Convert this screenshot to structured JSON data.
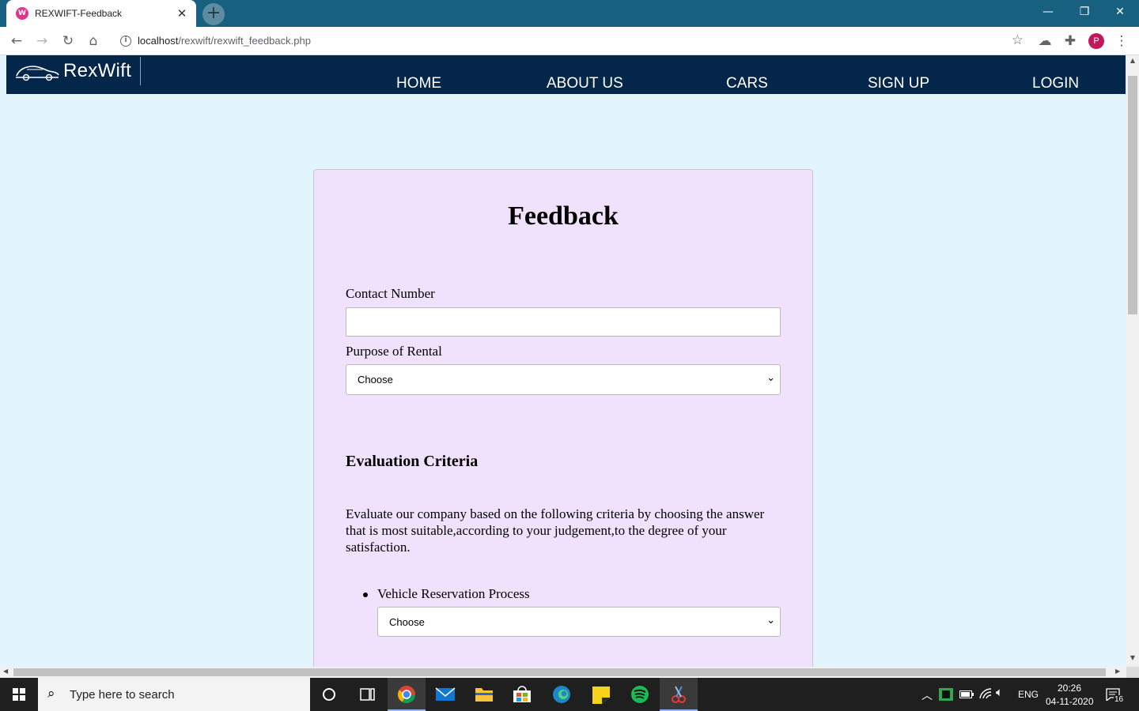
{
  "browser": {
    "tab_title": "REXWIFT-Feedback",
    "tab_favicon_letter": "W",
    "close_tab_glyph": "✕",
    "new_tab_glyph": "+",
    "url_host": "localhost",
    "url_path": "/rexwift/rexwift_feedback.php",
    "profile_initial": "P",
    "window_controls": {
      "minimize": "—",
      "restore": "❐",
      "close": "✕"
    },
    "icons": [
      "back-arrow-icon",
      "forward-arrow-icon",
      "reload-icon",
      "home-icon",
      "site-info-icon",
      "bookmark-star-icon",
      "cloud-extension-icon",
      "puzzle-extensions-icon",
      "kebab-menu-icon"
    ]
  },
  "site": {
    "logo_text": "RexWift",
    "nav": [
      {
        "label": "HOME"
      },
      {
        "label": "ABOUT US"
      },
      {
        "label": "CARS"
      },
      {
        "label": "SIGN UP"
      },
      {
        "label": "LOGIN"
      }
    ]
  },
  "form": {
    "title": "Feedback",
    "contact_label": "Contact Number",
    "contact_value": "",
    "purpose_label": "Purpose of Rental",
    "purpose_selected": "Choose",
    "section_heading": "Evaluation Criteria",
    "instructions": "Evaluate our company based on the following criteria by choosing the answer that is most suitable,according to your judgement,to the degree of your satisfaction.",
    "criteria": [
      {
        "label": "Vehicle Reservation Process",
        "selected": "Choose"
      }
    ]
  },
  "taskbar": {
    "search_placeholder": "Type here to search",
    "apps": [
      "cortana-icon",
      "task-view-icon",
      "chrome-icon",
      "mail-icon",
      "file-explorer-icon",
      "store-icon",
      "edge-icon",
      "sticky-notes-icon",
      "spotify-icon",
      "snipping-tool-icon"
    ],
    "language": "ENG",
    "time": "20:26",
    "date": "04-11-2020",
    "notification_count": "16"
  },
  "colors": {
    "tabstrip": "#17607f",
    "site_nav": "#04264a",
    "page_bg": "#e2f5fd",
    "card_bg": "#f0e2fc",
    "taskbar": "#1f1f1f"
  }
}
